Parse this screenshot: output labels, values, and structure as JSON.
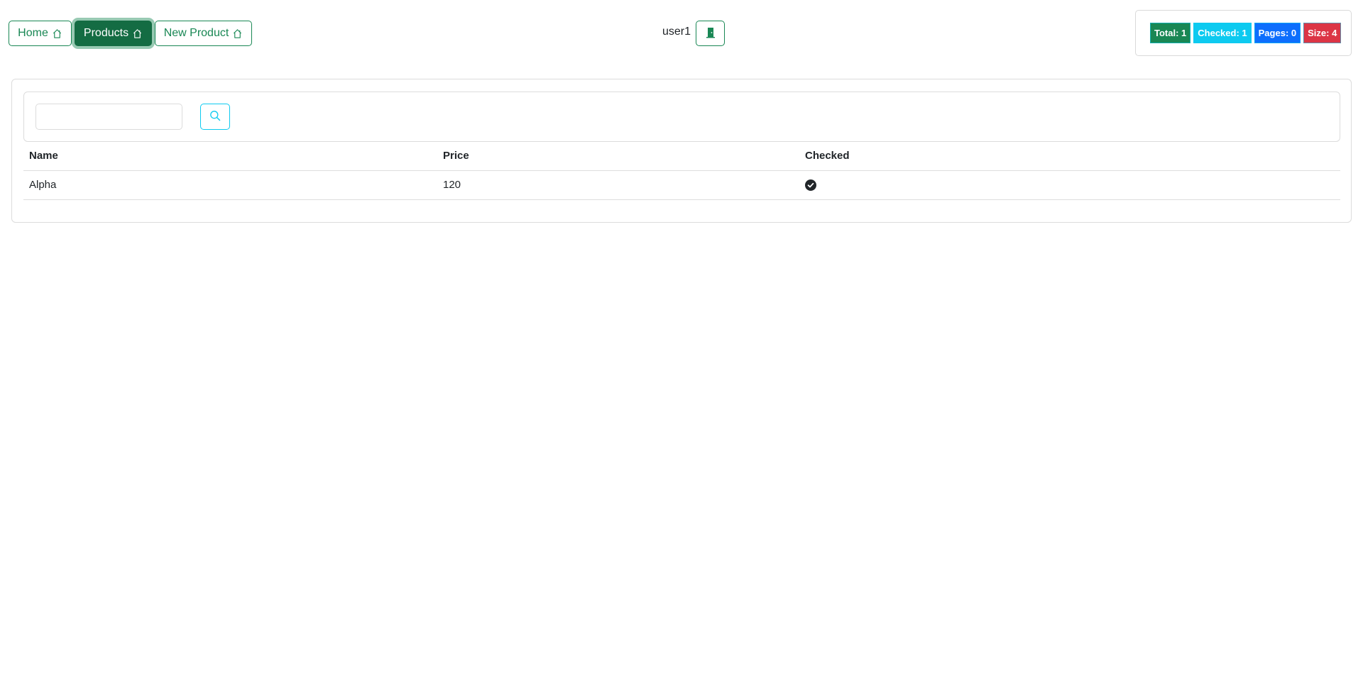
{
  "nav": {
    "items": [
      {
        "label": "Home",
        "icon": "home-icon",
        "active": false
      },
      {
        "label": "Products",
        "icon": "home-icon",
        "active": true
      },
      {
        "label": "New Product",
        "icon": "home-icon",
        "active": false
      }
    ]
  },
  "user": {
    "name": "user1",
    "logout_icon": "door-icon"
  },
  "stats": {
    "badges": [
      {
        "label": "Total: 1",
        "color": "#198754"
      },
      {
        "label": "Checked: 1",
        "color": "#0dcaf0"
      },
      {
        "label": "Pages: 0",
        "color": "#0d6efd"
      },
      {
        "label": "Size: 4",
        "color": "#dc3545"
      }
    ]
  },
  "search": {
    "value": "",
    "placeholder": "",
    "button_icon": "search-icon"
  },
  "table": {
    "columns": [
      "Name",
      "Price",
      "Checked"
    ],
    "rows": [
      {
        "name": "Alpha",
        "price": "120",
        "checked": true
      }
    ]
  },
  "colors": {
    "primary_green": "#198754",
    "active_green": "#146c43",
    "info": "#0dcaf0",
    "primary_blue": "#0d6efd",
    "danger": "#dc3545"
  }
}
